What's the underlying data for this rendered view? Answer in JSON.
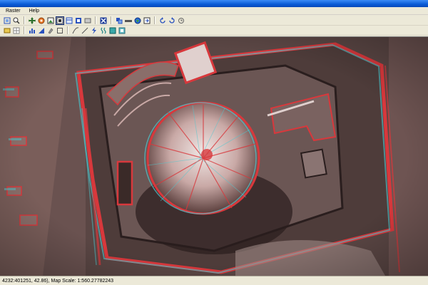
{
  "menubar": {
    "items": [
      "Raster",
      "Help"
    ]
  },
  "toolbar1": {
    "icons": [
      "zoom-extent-icon",
      "zoom-in-icon",
      "pan-icon",
      "refresh-icon",
      "full-view-icon",
      "zoom-layer-icon",
      "zoom-window-icon",
      "zoom-previous-icon",
      "zoom-next-icon",
      "clear-icon",
      "select-icon",
      "measure-icon",
      "globe-icon",
      "export-icon",
      "rotate-left-icon",
      "rotate-right-icon",
      "undo-icon"
    ]
  },
  "toolbar2": {
    "icons": [
      "settings-icon",
      "histogram-icon",
      "contrast-icon",
      "brush-icon",
      "box-icon",
      "curve-icon",
      "line-icon",
      "lightning-icon",
      "filter-icon",
      "layer-icon",
      "stack-icon"
    ]
  },
  "colors": {
    "titlebar": "#0a5bd6",
    "chrome": "#ece9d8",
    "anaglyph_red": "#d8383c",
    "anaglyph_cyan": "#4ec8d0"
  },
  "status": {
    "text": "4232:401251, 42.86), Map Scale: 1:560.27782243"
  }
}
